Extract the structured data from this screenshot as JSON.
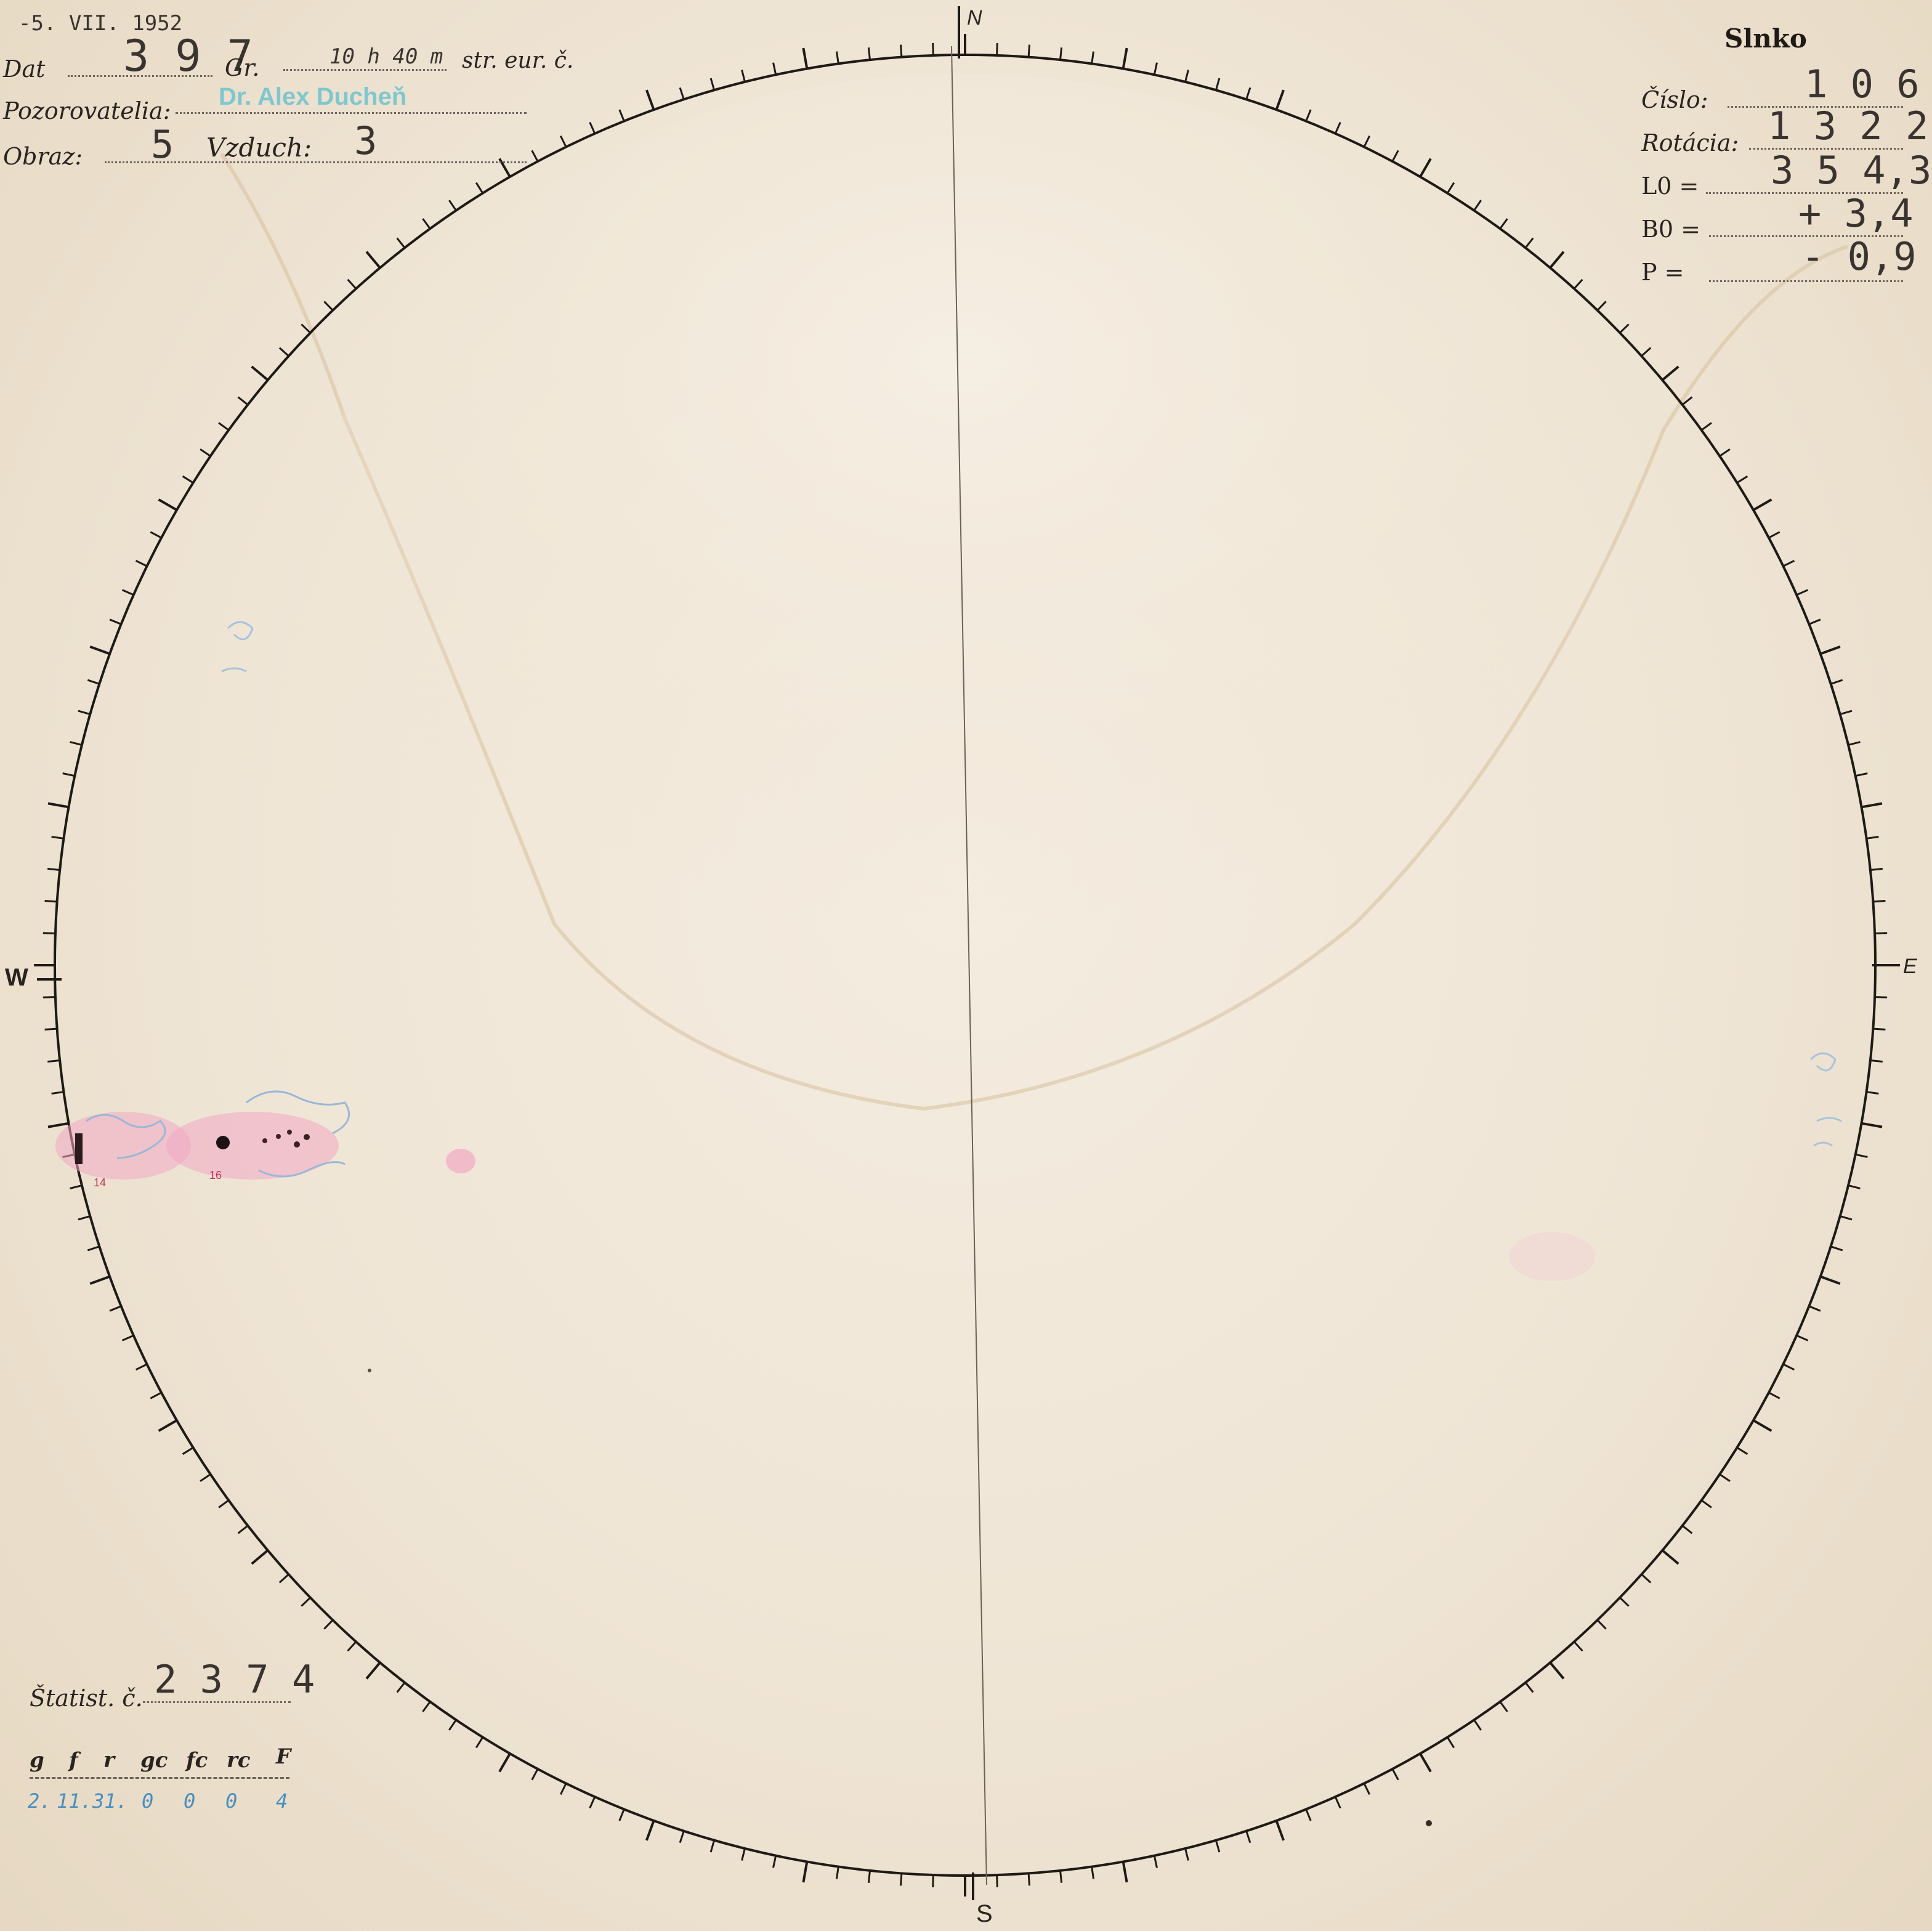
{
  "stamp_date": "-5. VII. 1952",
  "header": {
    "dat_label": "Dat",
    "dat_value": "3 9 7",
    "gr_label": "Gr.",
    "gr_value": "10  h 40 m",
    "time_suffix": "str. eur. č.",
    "observers_label": "Pozorovatelia:",
    "observers_value": "Dr. Alex Ducheň",
    "image_label": "Obraz:",
    "image_value": "5",
    "air_label": "Vzduch:",
    "air_value": "3"
  },
  "sun_panel": {
    "title": "Slnko",
    "rows": [
      {
        "label": "Číslo:",
        "value": "1 0 6"
      },
      {
        "label": "Rotácia:",
        "value": "1 3 2 2"
      },
      {
        "label": "L0 =",
        "value": "3 5 4,3"
      },
      {
        "label": "B0 =",
        "value": "+ 3,4"
      },
      {
        "label": "P =",
        "value": "- 0,9"
      }
    ]
  },
  "cardinals": {
    "north": "N",
    "south": "S",
    "west": "W",
    "east": "E"
  },
  "statistics": {
    "label": "Štatist. č.",
    "value": "2 3 7 4",
    "headers": [
      "g",
      "f",
      "r",
      "gc",
      "fc",
      "rc",
      "F"
    ],
    "values": [
      "2.",
      "11.",
      "31.",
      "0",
      "0",
      "0",
      "4"
    ]
  },
  "spot_groups": [
    {
      "number": "14"
    },
    {
      "number": "16"
    }
  ],
  "colors": {
    "paper": "#efe5d5",
    "ink": "#2a2420",
    "stamp_cyan": "#7fc7cf",
    "faculae_pink": "#f0a0c0",
    "pencil_blue": "#9ab8d8"
  }
}
